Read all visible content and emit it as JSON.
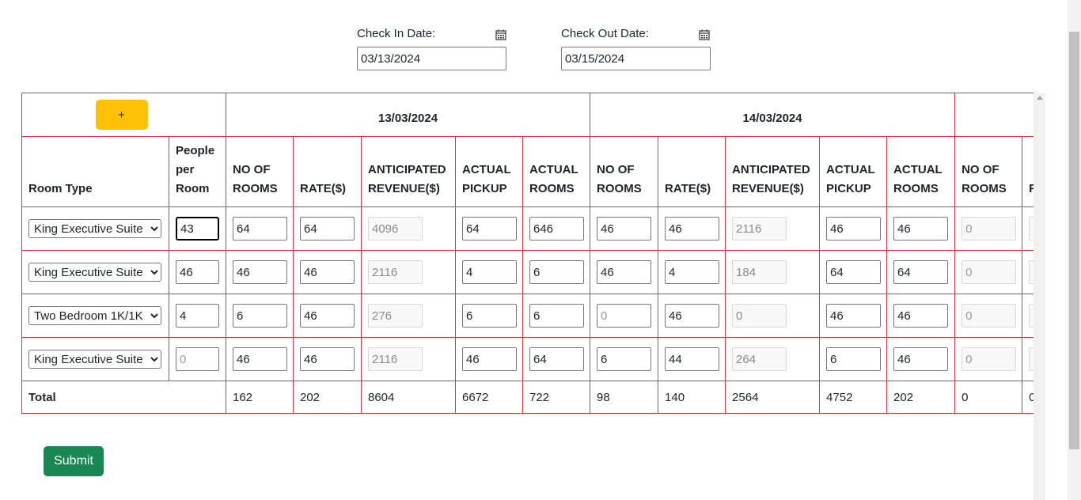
{
  "dates": {
    "check_in_label": "Check In Date:",
    "check_in_value": "03/13/2024",
    "check_out_label": "Check Out Date:",
    "check_out_value": "03/15/2024",
    "icon": "calendar-icon"
  },
  "table": {
    "add_label": "+",
    "date_headers": [
      "13/03/2024",
      "14/03/2024"
    ],
    "col_room_type": "Room Type",
    "col_people": "People per Room",
    "day_columns": [
      "NO OF ROOMS",
      "RATE($)",
      "ANTICIPATED REVENUE($)",
      "ACTUAL PICKUP",
      "ACTUAL ROOMS"
    ],
    "partial_columns": [
      "NO OF ROOMS",
      "R"
    ],
    "rows": [
      {
        "room": "King Executive Suite",
        "people": "43",
        "people_placeholder": "",
        "d1": [
          "64",
          "64",
          "4096",
          "64",
          "646"
        ],
        "d2": [
          "46",
          "46",
          "2116",
          "46",
          "46"
        ],
        "d3": [
          "",
          "0"
        ]
      },
      {
        "room": "King Executive Suite",
        "people": "46",
        "people_placeholder": "",
        "d1": [
          "46",
          "46",
          "2116",
          "4",
          "6"
        ],
        "d2": [
          "46",
          "4",
          "184",
          "64",
          "64"
        ],
        "d3": [
          "",
          "0"
        ]
      },
      {
        "room": "Two Bedroom 1K/1K",
        "people": "4",
        "people_placeholder": "",
        "d1": [
          "6",
          "46",
          "276",
          "6",
          "6"
        ],
        "d2": [
          "",
          "46",
          "0",
          "46",
          "46"
        ],
        "d3": [
          "",
          "0"
        ]
      },
      {
        "room": "King Executive Suite",
        "people": "",
        "people_placeholder": "0",
        "d1": [
          "46",
          "46",
          "2116",
          "46",
          "64"
        ],
        "d2": [
          "6",
          "44",
          "264",
          "6",
          "46"
        ],
        "d3": [
          "",
          "0"
        ]
      }
    ],
    "row_placeholders": {
      "zero": "0"
    },
    "total_label": "Total",
    "totals": [
      "162",
      "202",
      "8604",
      "6672",
      "722",
      "98",
      "140",
      "2564",
      "4752",
      "202",
      "0",
      "0"
    ]
  },
  "submit_label": "Submit",
  "colors": {
    "border": "#dc3545",
    "add": "#ffc107",
    "submit": "#198754"
  }
}
